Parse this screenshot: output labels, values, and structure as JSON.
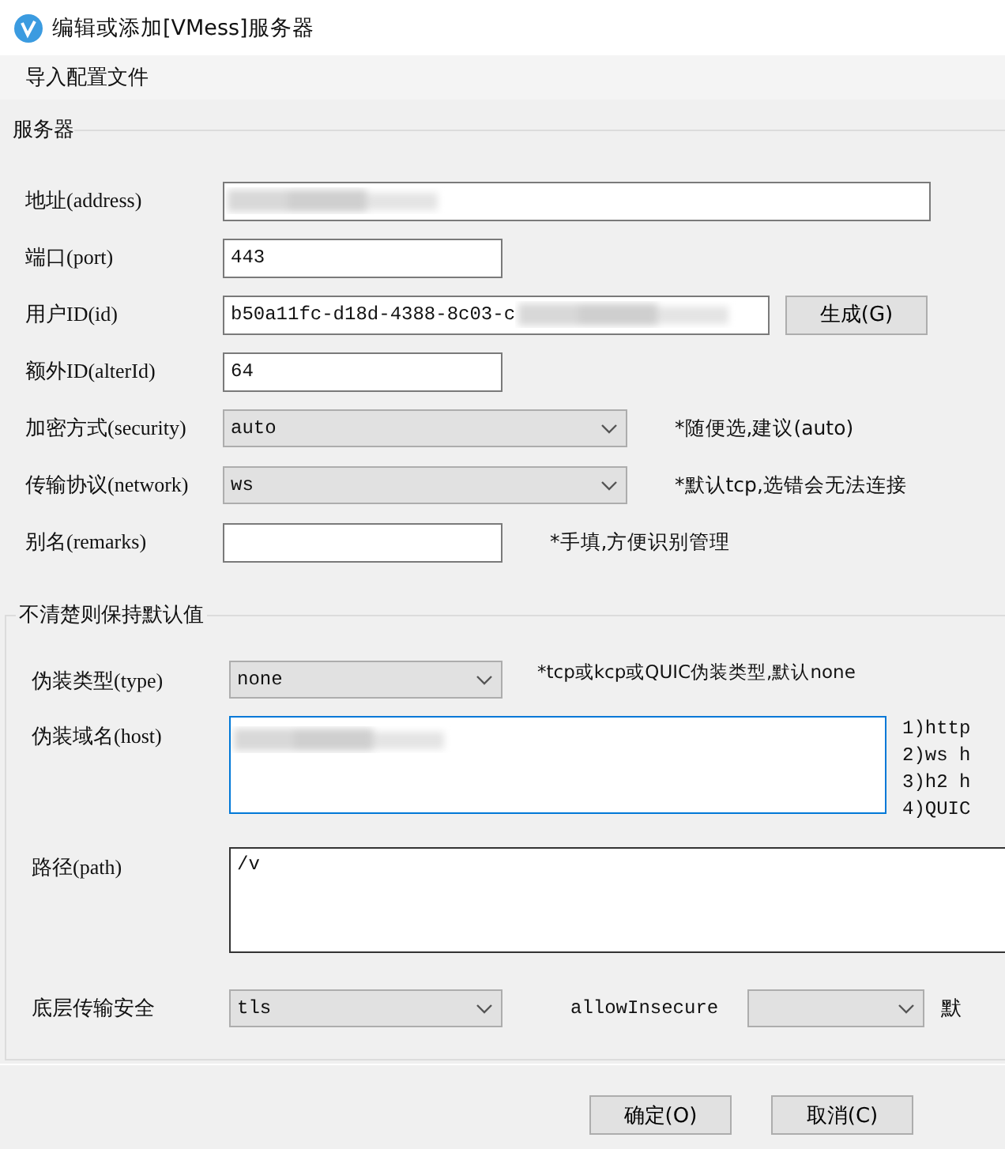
{
  "window": {
    "title": "编辑或添加[VMess]服务器"
  },
  "menu": [
    {
      "label": "导入配置文件"
    }
  ],
  "server_group": {
    "title": "服务器",
    "fields": [
      {
        "kind": "text",
        "label": "地址(address)",
        "redacted": true
      },
      {
        "kind": "text",
        "label": "端口(port)",
        "value": "443"
      },
      {
        "kind": "text",
        "label": "用户ID(id)",
        "value": "b50a11fc-d18d-4388-8c03-c",
        "redacted": true,
        "button": "生成(G)"
      },
      {
        "kind": "text",
        "label": "额外ID(alterId)",
        "value": "64"
      },
      {
        "kind": "select",
        "label": "加密方式(security)",
        "value": "auto",
        "note": "*随便选,建议(auto)"
      },
      {
        "kind": "select",
        "label": "传输协议(network)",
        "value": "ws",
        "note": "*默认tcp,选错会无法连接"
      },
      {
        "kind": "text",
        "label": "别名(remarks)",
        "note": "*手填,方便识别管理"
      }
    ]
  },
  "advanced_group": {
    "title": "不清楚则保持默认值",
    "fields": [
      {
        "kind": "select",
        "label": "伪装类型(type)",
        "value": "none",
        "note": "*tcp或kcp或QUIC伪装类型,默认none"
      },
      {
        "kind": "textarea",
        "label": "伪装域名(host)",
        "redacted": true,
        "focused": true,
        "notes": [
          "1)http",
          "2)ws h",
          "3)h2 h",
          "4)QUIC"
        ]
      },
      {
        "kind": "textarea",
        "label": "路径(path)",
        "value": "/v",
        "focused": false
      },
      {
        "kind": "select",
        "label": "底层传输安全",
        "value": "tls",
        "extra_label": "allowInsecure",
        "extra_note": "默"
      }
    ]
  },
  "buttons": [
    {
      "label": "确定(O)"
    },
    {
      "label": "取消(C)"
    }
  ]
}
